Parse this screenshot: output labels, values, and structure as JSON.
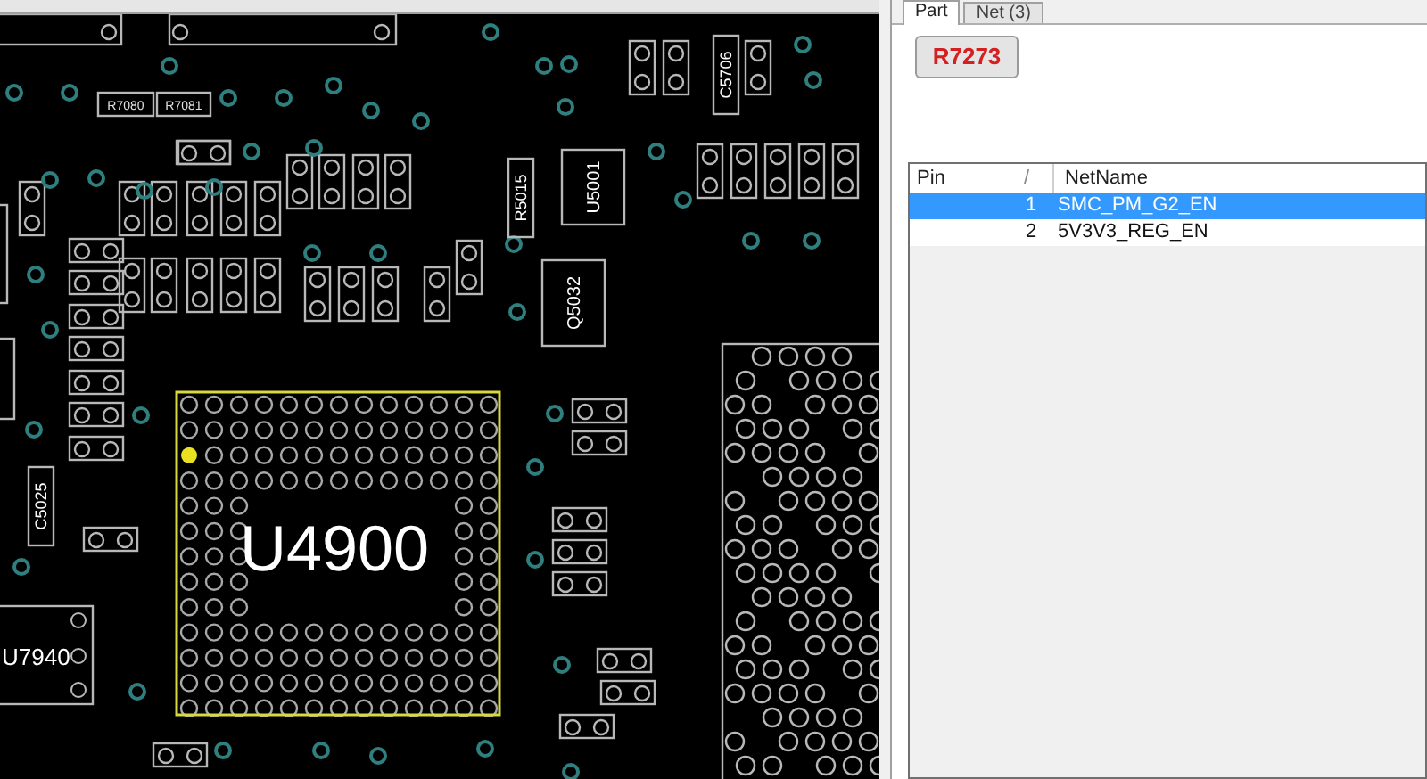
{
  "board": {
    "parts": [
      {
        "label": "R7080",
        "kind": "small"
      },
      {
        "label": "R7081",
        "kind": "small"
      },
      {
        "label": "R5015",
        "kind": "vertical"
      },
      {
        "label": "U5001",
        "kind": "vertical"
      },
      {
        "label": "Q5032",
        "kind": "vertical"
      },
      {
        "label": "C5706",
        "kind": "vertical"
      },
      {
        "label": "C5025",
        "kind": "vertical"
      },
      {
        "label": "U4900",
        "kind": "bga"
      },
      {
        "label": "U7940",
        "kind": "chip"
      }
    ]
  },
  "panel": {
    "tabs": [
      {
        "label": "Part",
        "selected": true
      },
      {
        "label": "Net (3)",
        "selected": false
      }
    ],
    "part_button": "R7273",
    "table": {
      "columns": [
        "Pin",
        "/",
        "NetName"
      ],
      "rows": [
        {
          "pin": "1",
          "net": "SMC_PM_G2_EN",
          "selected": true
        },
        {
          "pin": "2",
          "net": "5V3V3_REG_EN",
          "selected": false
        }
      ]
    }
  }
}
